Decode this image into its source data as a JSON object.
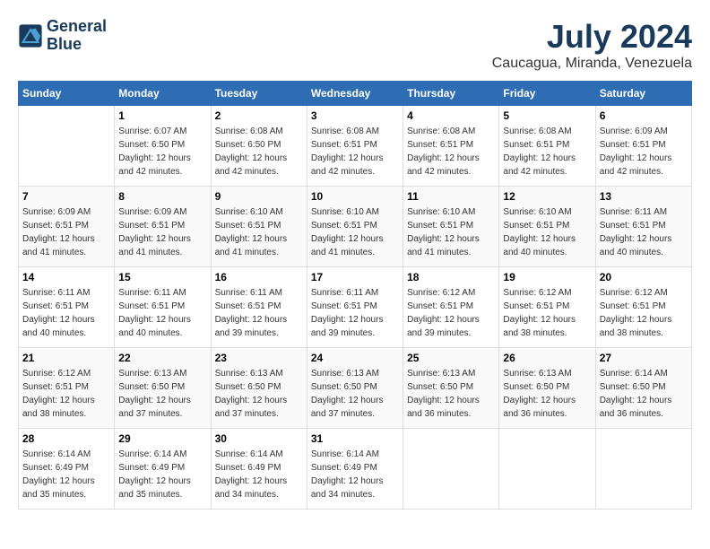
{
  "header": {
    "logo_line1": "General",
    "logo_line2": "Blue",
    "month_year": "July 2024",
    "location": "Caucagua, Miranda, Venezuela"
  },
  "days_of_week": [
    "Sunday",
    "Monday",
    "Tuesday",
    "Wednesday",
    "Thursday",
    "Friday",
    "Saturday"
  ],
  "weeks": [
    [
      {
        "day": "",
        "sunrise": "",
        "sunset": "",
        "daylight": ""
      },
      {
        "day": "1",
        "sunrise": "Sunrise: 6:07 AM",
        "sunset": "Sunset: 6:50 PM",
        "daylight": "Daylight: 12 hours and 42 minutes."
      },
      {
        "day": "2",
        "sunrise": "Sunrise: 6:08 AM",
        "sunset": "Sunset: 6:50 PM",
        "daylight": "Daylight: 12 hours and 42 minutes."
      },
      {
        "day": "3",
        "sunrise": "Sunrise: 6:08 AM",
        "sunset": "Sunset: 6:51 PM",
        "daylight": "Daylight: 12 hours and 42 minutes."
      },
      {
        "day": "4",
        "sunrise": "Sunrise: 6:08 AM",
        "sunset": "Sunset: 6:51 PM",
        "daylight": "Daylight: 12 hours and 42 minutes."
      },
      {
        "day": "5",
        "sunrise": "Sunrise: 6:08 AM",
        "sunset": "Sunset: 6:51 PM",
        "daylight": "Daylight: 12 hours and 42 minutes."
      },
      {
        "day": "6",
        "sunrise": "Sunrise: 6:09 AM",
        "sunset": "Sunset: 6:51 PM",
        "daylight": "Daylight: 12 hours and 42 minutes."
      }
    ],
    [
      {
        "day": "7",
        "sunrise": "Sunrise: 6:09 AM",
        "sunset": "Sunset: 6:51 PM",
        "daylight": "Daylight: 12 hours and 41 minutes."
      },
      {
        "day": "8",
        "sunrise": "Sunrise: 6:09 AM",
        "sunset": "Sunset: 6:51 PM",
        "daylight": "Daylight: 12 hours and 41 minutes."
      },
      {
        "day": "9",
        "sunrise": "Sunrise: 6:10 AM",
        "sunset": "Sunset: 6:51 PM",
        "daylight": "Daylight: 12 hours and 41 minutes."
      },
      {
        "day": "10",
        "sunrise": "Sunrise: 6:10 AM",
        "sunset": "Sunset: 6:51 PM",
        "daylight": "Daylight: 12 hours and 41 minutes."
      },
      {
        "day": "11",
        "sunrise": "Sunrise: 6:10 AM",
        "sunset": "Sunset: 6:51 PM",
        "daylight": "Daylight: 12 hours and 41 minutes."
      },
      {
        "day": "12",
        "sunrise": "Sunrise: 6:10 AM",
        "sunset": "Sunset: 6:51 PM",
        "daylight": "Daylight: 12 hours and 40 minutes."
      },
      {
        "day": "13",
        "sunrise": "Sunrise: 6:11 AM",
        "sunset": "Sunset: 6:51 PM",
        "daylight": "Daylight: 12 hours and 40 minutes."
      }
    ],
    [
      {
        "day": "14",
        "sunrise": "Sunrise: 6:11 AM",
        "sunset": "Sunset: 6:51 PM",
        "daylight": "Daylight: 12 hours and 40 minutes."
      },
      {
        "day": "15",
        "sunrise": "Sunrise: 6:11 AM",
        "sunset": "Sunset: 6:51 PM",
        "daylight": "Daylight: 12 hours and 40 minutes."
      },
      {
        "day": "16",
        "sunrise": "Sunrise: 6:11 AM",
        "sunset": "Sunset: 6:51 PM",
        "daylight": "Daylight: 12 hours and 39 minutes."
      },
      {
        "day": "17",
        "sunrise": "Sunrise: 6:11 AM",
        "sunset": "Sunset: 6:51 PM",
        "daylight": "Daylight: 12 hours and 39 minutes."
      },
      {
        "day": "18",
        "sunrise": "Sunrise: 6:12 AM",
        "sunset": "Sunset: 6:51 PM",
        "daylight": "Daylight: 12 hours and 39 minutes."
      },
      {
        "day": "19",
        "sunrise": "Sunrise: 6:12 AM",
        "sunset": "Sunset: 6:51 PM",
        "daylight": "Daylight: 12 hours and 38 minutes."
      },
      {
        "day": "20",
        "sunrise": "Sunrise: 6:12 AM",
        "sunset": "Sunset: 6:51 PM",
        "daylight": "Daylight: 12 hours and 38 minutes."
      }
    ],
    [
      {
        "day": "21",
        "sunrise": "Sunrise: 6:12 AM",
        "sunset": "Sunset: 6:51 PM",
        "daylight": "Daylight: 12 hours and 38 minutes."
      },
      {
        "day": "22",
        "sunrise": "Sunrise: 6:13 AM",
        "sunset": "Sunset: 6:50 PM",
        "daylight": "Daylight: 12 hours and 37 minutes."
      },
      {
        "day": "23",
        "sunrise": "Sunrise: 6:13 AM",
        "sunset": "Sunset: 6:50 PM",
        "daylight": "Daylight: 12 hours and 37 minutes."
      },
      {
        "day": "24",
        "sunrise": "Sunrise: 6:13 AM",
        "sunset": "Sunset: 6:50 PM",
        "daylight": "Daylight: 12 hours and 37 minutes."
      },
      {
        "day": "25",
        "sunrise": "Sunrise: 6:13 AM",
        "sunset": "Sunset: 6:50 PM",
        "daylight": "Daylight: 12 hours and 36 minutes."
      },
      {
        "day": "26",
        "sunrise": "Sunrise: 6:13 AM",
        "sunset": "Sunset: 6:50 PM",
        "daylight": "Daylight: 12 hours and 36 minutes."
      },
      {
        "day": "27",
        "sunrise": "Sunrise: 6:14 AM",
        "sunset": "Sunset: 6:50 PM",
        "daylight": "Daylight: 12 hours and 36 minutes."
      }
    ],
    [
      {
        "day": "28",
        "sunrise": "Sunrise: 6:14 AM",
        "sunset": "Sunset: 6:49 PM",
        "daylight": "Daylight: 12 hours and 35 minutes."
      },
      {
        "day": "29",
        "sunrise": "Sunrise: 6:14 AM",
        "sunset": "Sunset: 6:49 PM",
        "daylight": "Daylight: 12 hours and 35 minutes."
      },
      {
        "day": "30",
        "sunrise": "Sunrise: 6:14 AM",
        "sunset": "Sunset: 6:49 PM",
        "daylight": "Daylight: 12 hours and 34 minutes."
      },
      {
        "day": "31",
        "sunrise": "Sunrise: 6:14 AM",
        "sunset": "Sunset: 6:49 PM",
        "daylight": "Daylight: 12 hours and 34 minutes."
      },
      {
        "day": "",
        "sunrise": "",
        "sunset": "",
        "daylight": ""
      },
      {
        "day": "",
        "sunrise": "",
        "sunset": "",
        "daylight": ""
      },
      {
        "day": "",
        "sunrise": "",
        "sunset": "",
        "daylight": ""
      }
    ]
  ]
}
